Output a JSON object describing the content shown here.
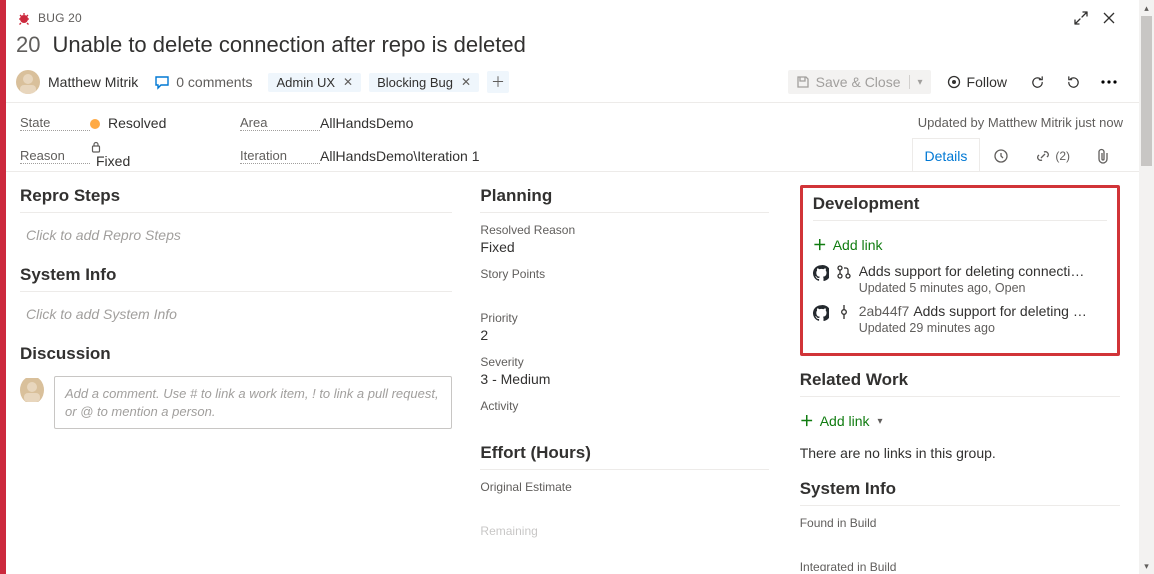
{
  "header": {
    "type_label": "BUG 20",
    "id": "20",
    "title": "Unable to delete connection after repo is deleted"
  },
  "assignee": {
    "name": "Matthew Mitrik"
  },
  "comments": {
    "label": "0 comments"
  },
  "tags": [
    {
      "label": "Admin UX"
    },
    {
      "label": "Blocking Bug"
    }
  ],
  "toolbar": {
    "save_label": "Save & Close",
    "follow_label": "Follow"
  },
  "classification": {
    "state_label": "State",
    "state_value": "Resolved",
    "reason_label": "Reason",
    "reason_value": "Fixed",
    "area_label": "Area",
    "area_value": "AllHandsDemo",
    "iteration_label": "Iteration",
    "iteration_value": "AllHandsDemo\\Iteration 1",
    "updated_text": "Updated by Matthew Mitrik just now"
  },
  "tabs": {
    "details": "Details",
    "links_count": "(2)"
  },
  "col1": {
    "repro_title": "Repro Steps",
    "repro_placeholder": "Click to add Repro Steps",
    "sysinfo_title": "System Info",
    "sysinfo_placeholder": "Click to add System Info",
    "discussion_title": "Discussion",
    "discussion_placeholder": "Add a comment. Use # to link a work item, ! to link a pull request, or @ to mention a person."
  },
  "col2": {
    "planning_title": "Planning",
    "resolved_reason_label": "Resolved Reason",
    "resolved_reason_value": "Fixed",
    "story_points_label": "Story Points",
    "priority_label": "Priority",
    "priority_value": "2",
    "severity_label": "Severity",
    "severity_value": "3 - Medium",
    "activity_label": "Activity",
    "effort_title": "Effort (Hours)",
    "original_estimate_label": "Original Estimate",
    "remaining_label": "Remaining"
  },
  "col3": {
    "dev_title": "Development",
    "add_link_label": "Add link",
    "items": [
      {
        "kind": "pr",
        "title": "Adds support for deleting connecti…",
        "meta": "Updated 5 minutes ago,  Open"
      },
      {
        "kind": "commit",
        "sha": "2ab44f7",
        "title": "Adds support for deleting …",
        "meta": "Updated 29 minutes ago"
      }
    ],
    "related_title": "Related Work",
    "related_add_link": "Add link",
    "related_empty": "There are no links in this group.",
    "sysinfo_title": "System Info",
    "found_in_build_label": "Found in Build",
    "integrated_in_build_label": "Integrated in Build"
  }
}
